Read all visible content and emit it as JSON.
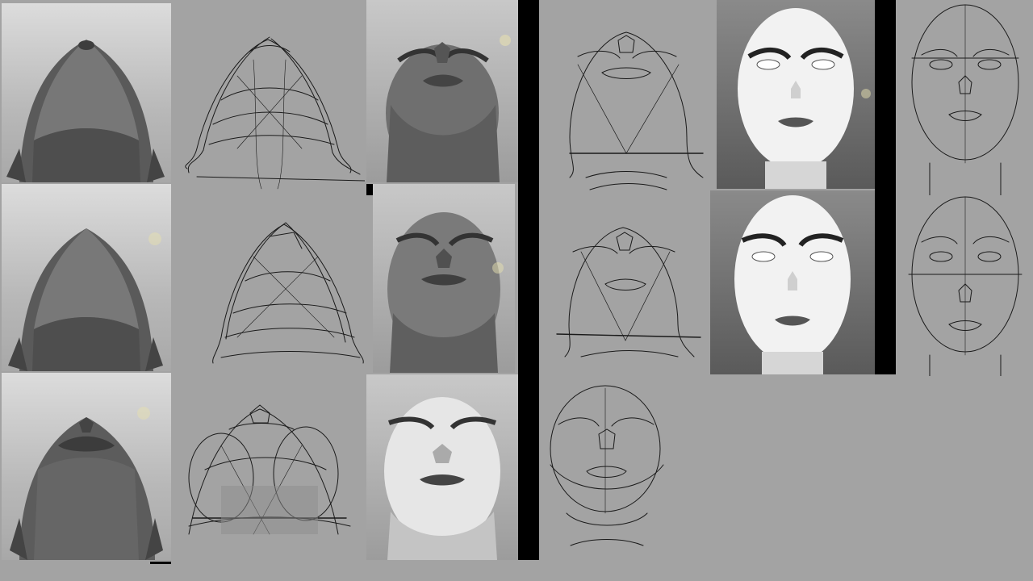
{
  "colors": {
    "canvas": "#a3a3a3",
    "divider": "#000000",
    "sketch_stroke": "#1a1a1a",
    "skin_dark": "#6b6b6b",
    "skin_light": "#f4f4f4"
  },
  "board": {
    "reference_rows": 3,
    "render_type": "3D head renders",
    "sketch_type": "pencil construction sketches",
    "groups": [
      {
        "name": "extreme-low-angle",
        "renders": 3,
        "sketches": 3
      },
      {
        "name": "low-angle-3-4-up",
        "renders": 3,
        "sketches": 3
      },
      {
        "name": "front-view",
        "renders": 2,
        "sketches": 2
      }
    ]
  }
}
